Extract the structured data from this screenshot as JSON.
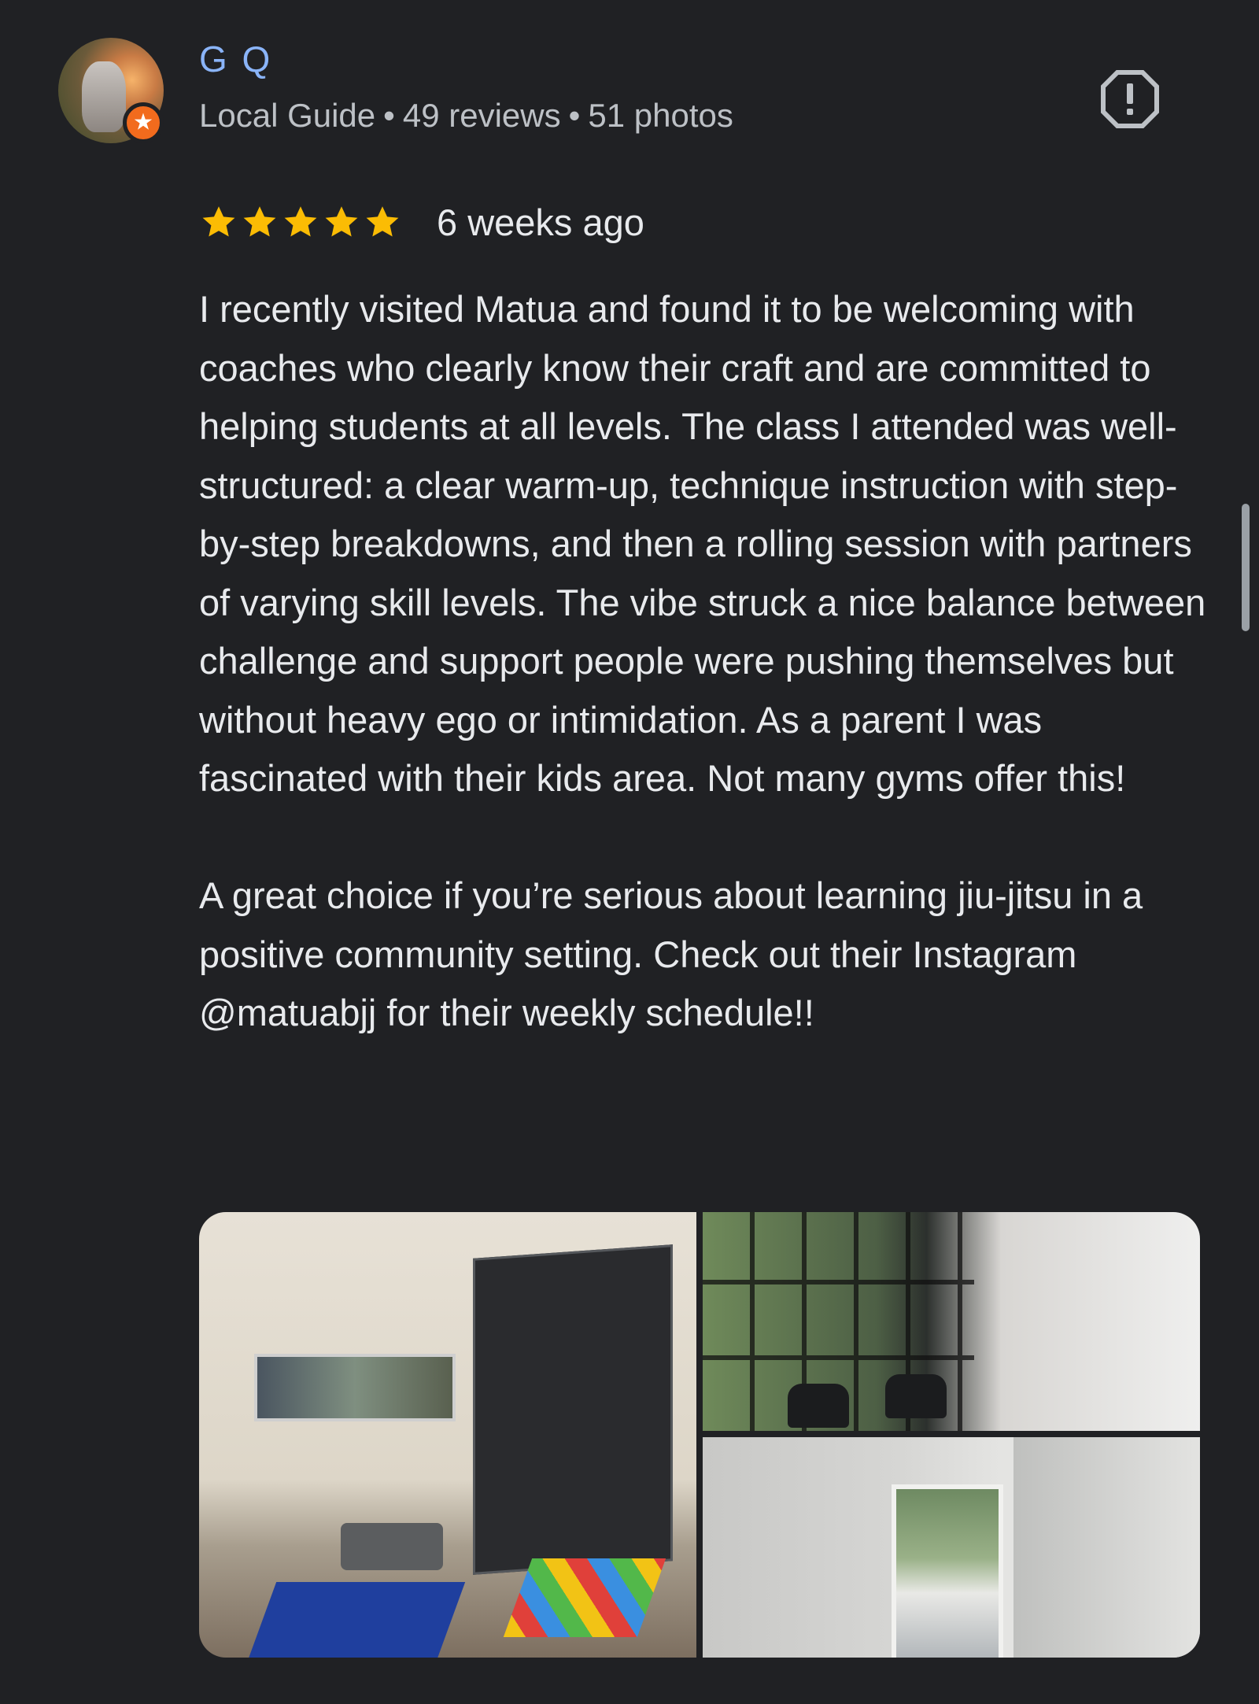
{
  "reviewer": {
    "name": "G Q",
    "badge": "Local Guide",
    "reviews": "49 reviews",
    "photos": "51 photos",
    "separator": "•"
  },
  "review": {
    "rating": 5,
    "rating_max": 5,
    "time": "6 weeks ago",
    "paragraphs": [
      "I recently visited Matua and found it to be welcoming with coaches who clearly know their craft and are committed to helping students at all levels. The class I attended was well-structured: a clear warm-up, technique instruction with step-by-step breakdowns, and then a rolling session with partners of varying skill levels. The vibe struck a nice balance between challenge and support people were pushing themselves but without heavy ego or intimidation. As a parent I was fascinated with their kids area. Not many gyms offer this!",
      "A great choice if you’re serious about learning jiu-jitsu in a positive community setting. Check out their Instagram @matuabjj for their weekly schedule!!"
    ]
  },
  "icons": {
    "report": "report-icon",
    "star": "star-icon",
    "local_guide": "local-guide-badge-icon"
  },
  "colors": {
    "background": "#202124",
    "name": "#8ab4f8",
    "star": "#fbbc04",
    "badge": "#f26b1d"
  },
  "photos": {
    "count": 3
  }
}
